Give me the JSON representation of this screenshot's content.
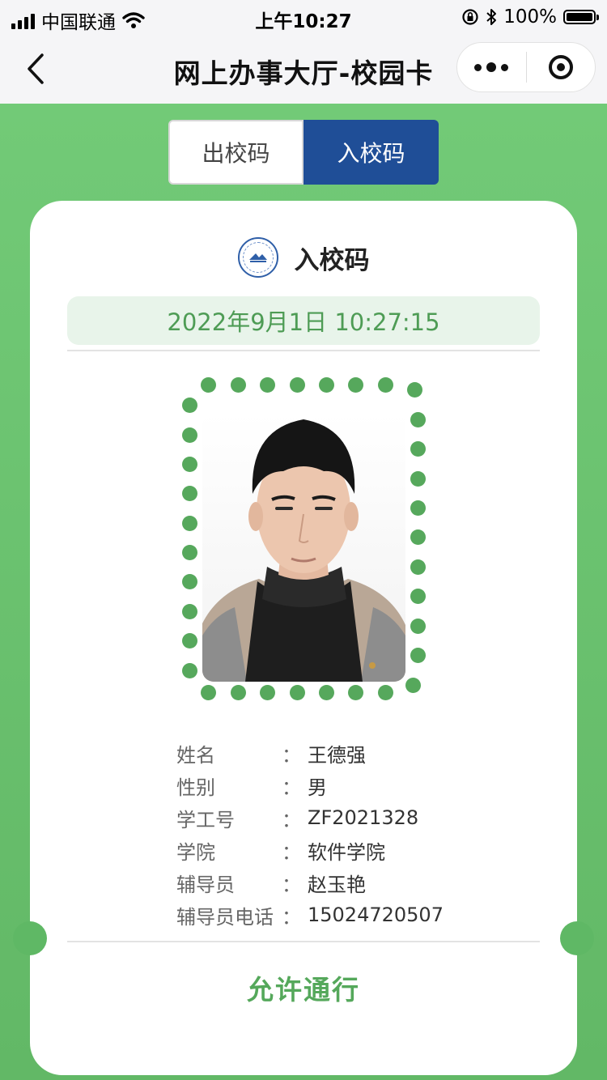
{
  "status_bar": {
    "carrier": "中国联通",
    "time": "上午10:27",
    "battery": "100%"
  },
  "nav": {
    "title": "网上办事大厅-校园卡"
  },
  "tabs": [
    {
      "label": "出校码",
      "active": false
    },
    {
      "label": "入校码",
      "active": true
    }
  ],
  "card": {
    "title": "入校码",
    "datetime": "2022年9月1日 10:27:15",
    "photo_icon": "person-photo",
    "fields": [
      {
        "label": "姓名",
        "colon": "：",
        "value": "王德强"
      },
      {
        "label": "性别",
        "colon": "：",
        "value": "男"
      },
      {
        "label": "学工号",
        "colon": "：",
        "value": "ZF2021328"
      },
      {
        "label": "学院",
        "colon": "：",
        "value": "软件学院"
      },
      {
        "label": "辅导员",
        "colon": "：",
        "value": "赵玉艳"
      },
      {
        "label": "辅导员电话",
        "colon": "：",
        "value": "15024720507"
      }
    ],
    "status": "允许通行"
  },
  "colors": {
    "accent_green": "#56a85c",
    "tab_active": "#1f4e97",
    "page_bg": "#66bf6c"
  }
}
